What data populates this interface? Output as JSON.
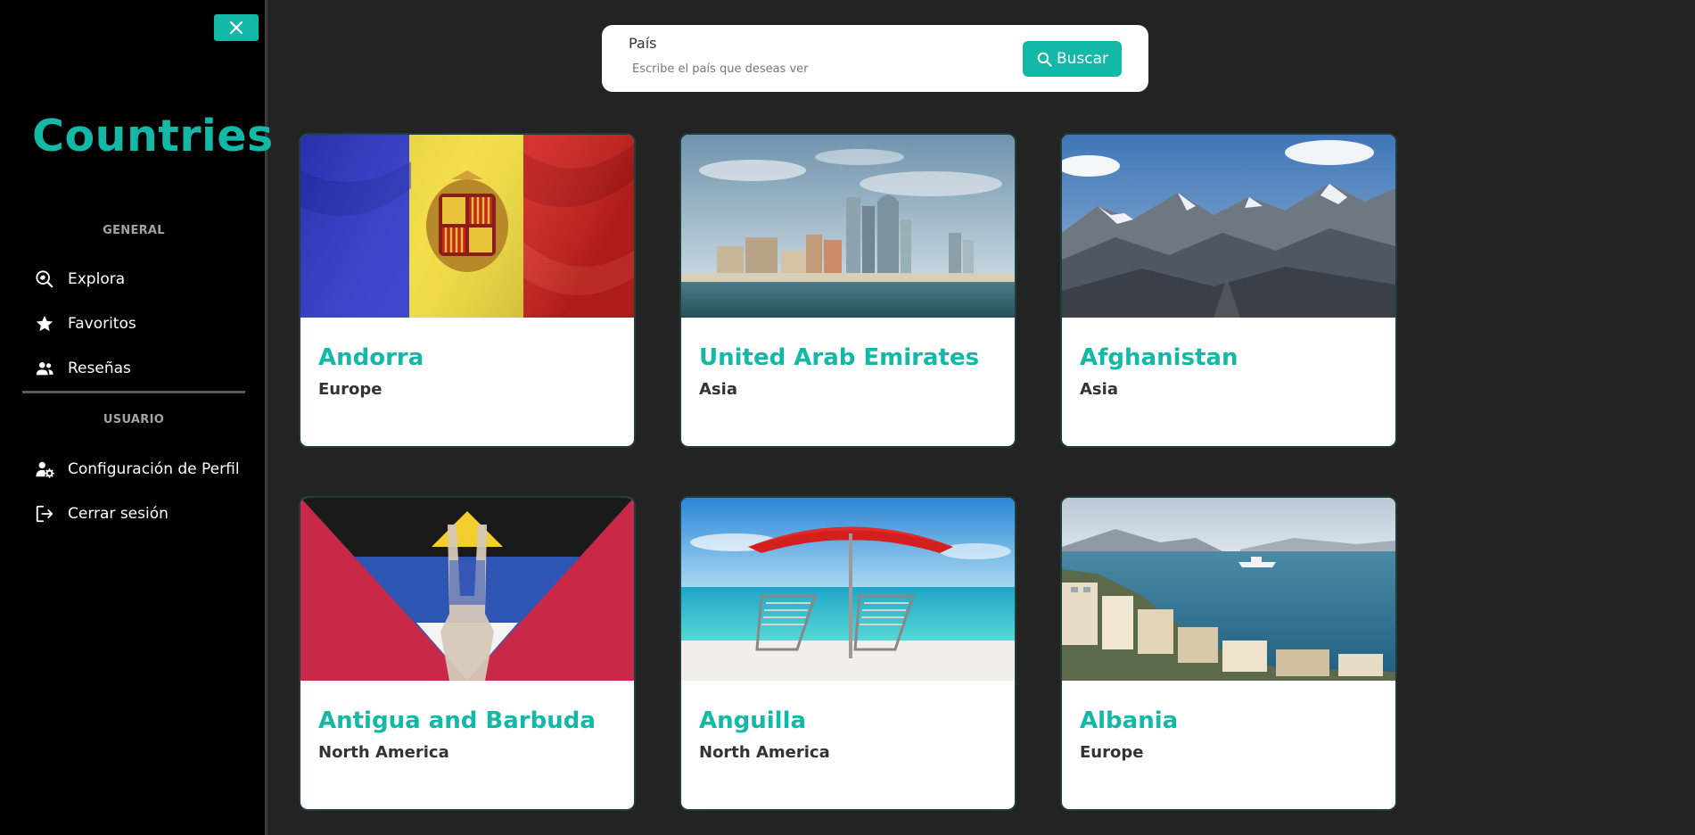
{
  "sidebar": {
    "brand": "Countries",
    "sections": {
      "general": "GENERAL",
      "user": "USUARIO"
    },
    "items": [
      {
        "label": "Explora",
        "icon": "explore-icon"
      },
      {
        "label": "Favoritos",
        "icon": "star-icon"
      },
      {
        "label": "Reseñas",
        "icon": "users-icon"
      },
      {
        "label": "Configuración de Perfil",
        "icon": "user-settings-icon"
      },
      {
        "label": "Cerrar sesión",
        "icon": "logout-icon"
      }
    ]
  },
  "search": {
    "label": "País",
    "placeholder": "Escribe el país que deseas ver",
    "value": "",
    "button_label": "Buscar"
  },
  "cards": [
    {
      "name": "Andorra",
      "region": "Europe"
    },
    {
      "name": "United Arab Emirates",
      "region": "Asia"
    },
    {
      "name": "Afghanistan",
      "region": "Asia"
    },
    {
      "name": "Antigua and Barbuda",
      "region": "North America"
    },
    {
      "name": "Anguilla",
      "region": "North America"
    },
    {
      "name": "Albania",
      "region": "Europe"
    }
  ],
  "colors": {
    "accent": "#14b8a6",
    "sidebar_bg": "#000000",
    "page_bg": "#232323"
  }
}
